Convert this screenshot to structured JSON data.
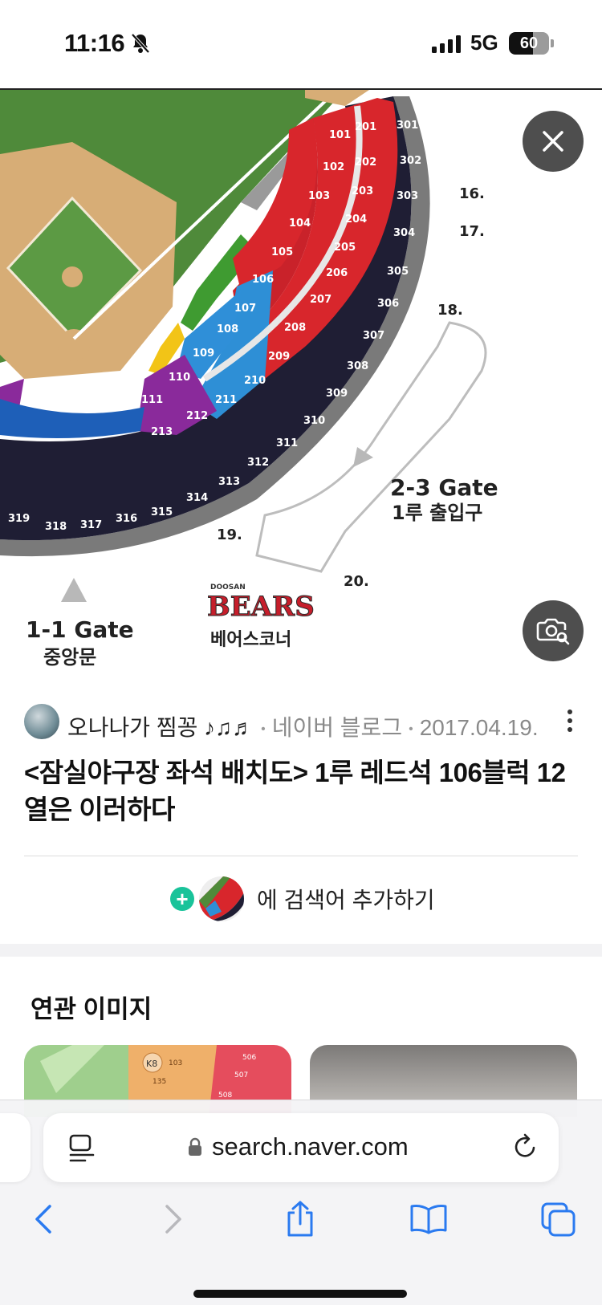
{
  "status_bar": {
    "time": "11:16",
    "network": "5G",
    "battery": "60",
    "battery_level": 0.6
  },
  "image": {
    "gate_1_1_title": "1-1 Gate",
    "gate_1_1_sub": "중앙문",
    "gate_2_3_title": "2-3 Gate",
    "gate_2_3_sub": "1루 출입구",
    "bears_small": "DOOSAN",
    "bears_logo": "BEARS",
    "bears_corner": "베어스코너",
    "markers": [
      "16.",
      "17.",
      "18.",
      "19.",
      "20."
    ],
    "sections_200": [
      "201",
      "202",
      "203",
      "204",
      "205",
      "206",
      "207",
      "208"
    ],
    "sections_100": [
      "101",
      "102",
      "103",
      "104",
      "105",
      "106"
    ],
    "sections_blue": [
      "107",
      "108",
      "109",
      "209",
      "210",
      "211"
    ],
    "sections_purple": [
      "110",
      "111",
      "212",
      "213"
    ],
    "sections_300": [
      "301",
      "302",
      "303",
      "304",
      "305",
      "306",
      "307",
      "308",
      "309",
      "310",
      "311",
      "312",
      "313",
      "314",
      "315",
      "316",
      "317",
      "318",
      "319"
    ]
  },
  "buttons": {
    "close_icon": "close-icon",
    "lens_icon": "image-search-icon"
  },
  "post": {
    "author": "오나나가 찜꽁 ♪♫♬",
    "source": "네이버 블로그",
    "date": "2017.04.19.",
    "title": "<잠실야구장 좌석 배치도> 1루 레드석 106블럭 12열은 이러하다"
  },
  "add_search": {
    "label": "에 검색어 추가하기",
    "plus": "+"
  },
  "related": {
    "title": "연관 이미지",
    "thumb1_labels": [
      "K8",
      "506",
      "507",
      "508",
      "103",
      "135"
    ]
  },
  "browser": {
    "url": "search.naver.com"
  },
  "colors": {
    "red": "#d8262c",
    "blue": "#2e8fd6",
    "purple": "#8a2a9b",
    "navy": "#1e1d33",
    "field": "#5a8f3e",
    "dirt": "#d9b07a",
    "accent": "#19c39a"
  }
}
